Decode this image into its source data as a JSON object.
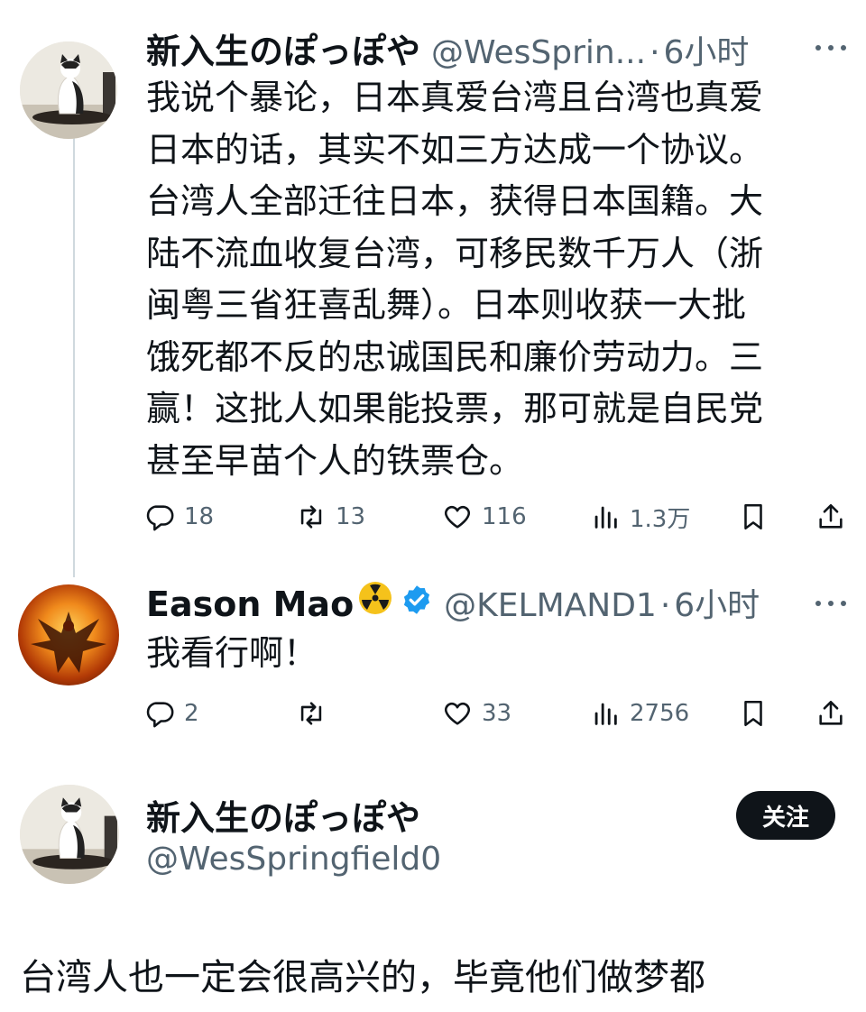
{
  "colors": {
    "text": "#0f1419",
    "secondary": "#536471",
    "verified": "#1d9bf0",
    "follow_bg": "#0f1419",
    "thread_line": "#cfd9de"
  },
  "tweet1": {
    "name": "新入生のぽっぽや",
    "handle": "@WesSprin...",
    "separator": "·",
    "time": "6小时",
    "lines": [
      "我说个暴论，日本真爱台湾且台湾也真爱",
      "日本的话，其实不如三方达成一个协议。",
      "台湾人全部迁往日本，获得日本国籍。大",
      "陆不流血收复台湾，可移民数千万人（浙",
      "闽粤三省狂喜乱舞）。日本则收获一大批",
      "饿死都不反的忠诚国民和廉价劳动力。三",
      "赢！这批人如果能投票，那可就是自民党",
      "甚至早苗个人的铁票仓。"
    ],
    "replies": "18",
    "retweets": "13",
    "likes": "116",
    "views": "1.3万"
  },
  "tweet2": {
    "name": "Eason Mao",
    "handle": "@KELMAND1",
    "separator": "·",
    "time": "6小时",
    "text": "我看行啊！",
    "replies": "2",
    "retweets": "",
    "likes": "33",
    "views": "2756"
  },
  "profile": {
    "name": "新入生のぽっぽや",
    "handle": "@WesSpringfield0",
    "follow_label": "关注"
  },
  "main_tweet": {
    "text": "台湾人也一定会很高兴的，毕竟他们做梦都"
  },
  "icons": [
    "more-icon",
    "reply-icon",
    "retweet-icon",
    "like-icon",
    "views-icon",
    "bookmark-icon",
    "share-icon",
    "verified-badge-icon",
    "radioactive-emoji-icon"
  ]
}
